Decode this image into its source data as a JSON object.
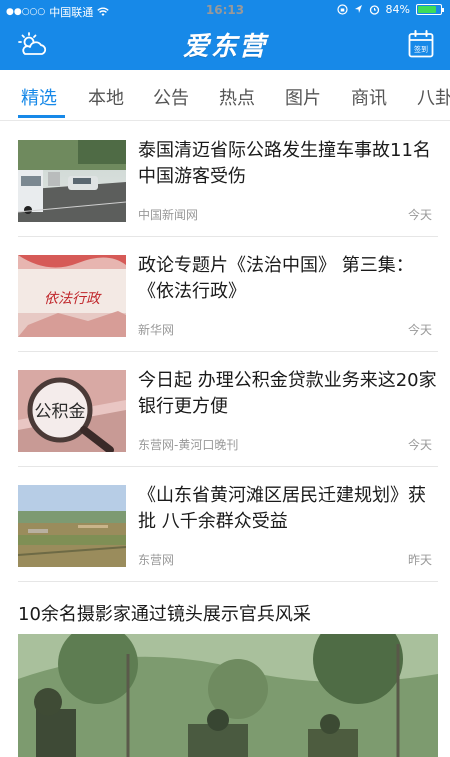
{
  "status_bar": {
    "carrier": "中国联通",
    "time": "16:13",
    "battery": "84%",
    "battery_level": 0.84
  },
  "app": {
    "title": "爱东营",
    "left_icon": "weather-icon",
    "right_icon": "calendar-signin-icon",
    "right_icon_text": "签到"
  },
  "tabs": [
    {
      "label": "精选",
      "active": true
    },
    {
      "label": "本地"
    },
    {
      "label": "公告"
    },
    {
      "label": "热点"
    },
    {
      "label": "图片"
    },
    {
      "label": "商讯"
    },
    {
      "label": "八卦"
    }
  ],
  "news": [
    {
      "headline": "泰国清迈省际公路发生撞车事故11名中国游客受伤",
      "source": "中国新闻网",
      "time": "今天",
      "thumb_alt": "traffic-accident-photo"
    },
    {
      "headline": "政论专题片《法治中国》 第三集：《依法行政》",
      "source": "新华网",
      "time": "今天",
      "thumb_alt": "rule-of-law-poster",
      "thumb_text": "依法行政"
    },
    {
      "headline": "今日起 办理公积金贷款业务来这20家银行更方便",
      "source": "东营网-黄河口晚刊",
      "time": "今天",
      "thumb_alt": "housing-fund-magnifier",
      "thumb_text": "公积金"
    },
    {
      "headline": "《山东省黄河滩区居民迁建规划》获批 八千余群众受益",
      "source": "东营网",
      "time": "昨天",
      "thumb_alt": "river-village-landscape"
    }
  ],
  "featured": {
    "headline": "10余名摄影家通过镜头展示官兵风采",
    "image_alt": "soldiers-training-photo"
  }
}
